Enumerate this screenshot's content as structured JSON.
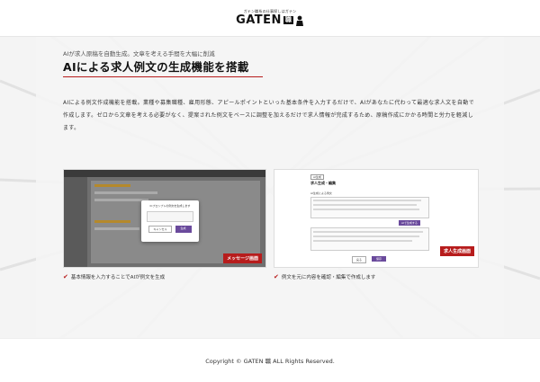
{
  "header": {
    "logo_tagline": "ガテン職系の仕事探しはガテン",
    "logo_text": "GATEN",
    "logo_mark": "職"
  },
  "section": {
    "kicker": "AIが求人原稿を自動生成。文章を考える手間を大幅に削減",
    "heading": "AIによる求人例文の生成機能を搭載",
    "description": "AIによる例文作成機能を搭載。業種や募集職種、雇用形態、アピールポイントといった基本条件を入力するだけで、AIがあなたに代わって最適な求人文を自動で作成します。ゼロから文章を考える必要がなく、提案された例文をベースに調整を加えるだけで求人情報が完成するため、原稿作成にかかる時間と労力を軽減します。"
  },
  "screenshots": [
    {
      "badge": "メッセージ画面",
      "caption": "基本情報を入力することでAIが例文を生成",
      "dialog_title": "ICプロンプトの例文を生成します",
      "dialog_cancel": "キャンセル",
      "dialog_ok": "生成"
    },
    {
      "badge": "求人生成画面",
      "caption": "例文を元に内容を確認・編集で作成します",
      "label_tag": "AI生成",
      "title": "求人生成・編集",
      "field_label": "AI生成による例文",
      "button_back": "戻る",
      "button_save": "保存",
      "button_generate": "AIで生成する"
    }
  ],
  "footer": {
    "copyright": "Copyright © GATEN 職 ALL Rights Reserved."
  },
  "colors": {
    "accent": "#b71c1c",
    "purple": "#6a4a9c"
  }
}
